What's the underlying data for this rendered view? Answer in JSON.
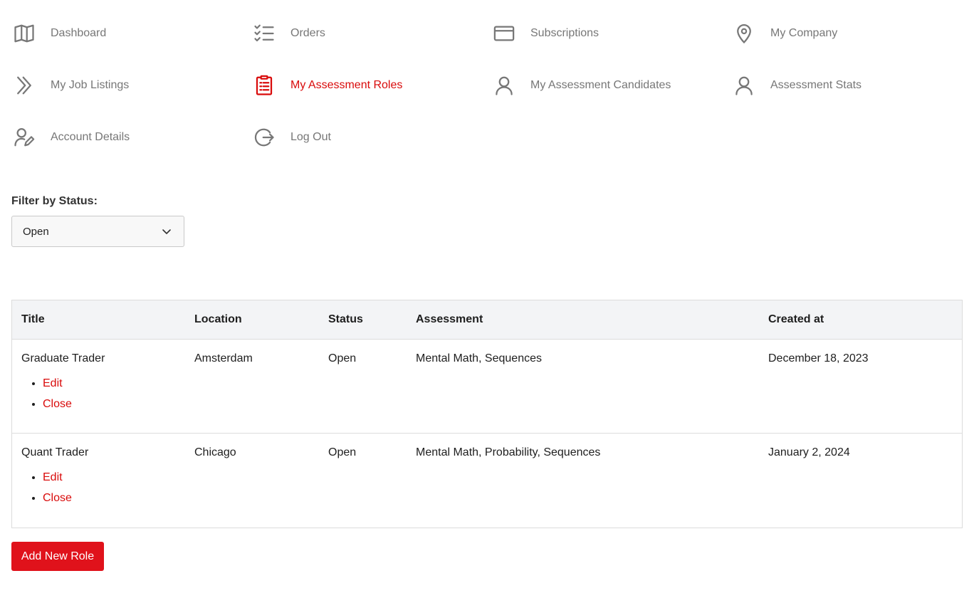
{
  "nav": {
    "items": [
      {
        "label": "Dashboard",
        "icon": "map-icon"
      },
      {
        "label": "Orders",
        "icon": "checklist-icon"
      },
      {
        "label": "Subscriptions",
        "icon": "credit-card-icon"
      },
      {
        "label": "My Company",
        "icon": "map-pin-icon"
      },
      {
        "label": "My Job Listings",
        "icon": "double-chevron-right-icon"
      },
      {
        "label": "My Assessment Roles",
        "icon": "clipboard-list-icon",
        "active": true
      },
      {
        "label": "My Assessment Candidates",
        "icon": "user-icon"
      },
      {
        "label": "Assessment Stats",
        "icon": "user-icon"
      },
      {
        "label": "Account Details",
        "icon": "user-edit-icon"
      },
      {
        "label": "Log Out",
        "icon": "logout-icon"
      }
    ],
    "active_color": "#d90b0b",
    "text_color": "#777777"
  },
  "filter": {
    "label": "Filter by Status:",
    "selected": "Open"
  },
  "table": {
    "headers": [
      "Title",
      "Location",
      "Status",
      "Assessment",
      "Created at"
    ],
    "rows": [
      {
        "title": "Graduate Trader",
        "location": "Amsterdam",
        "status": "Open",
        "assessment": "Mental Math, Sequences",
        "created_at": "December 18, 2023",
        "actions": [
          "Edit",
          "Close"
        ]
      },
      {
        "title": "Quant Trader",
        "location": "Chicago",
        "status": "Open",
        "assessment": "Mental Math, Probability, Sequences",
        "created_at": "January 2, 2024",
        "actions": [
          "Edit",
          "Close"
        ]
      }
    ]
  },
  "add_button": {
    "label": "Add New Role",
    "color": "#e0121b"
  }
}
